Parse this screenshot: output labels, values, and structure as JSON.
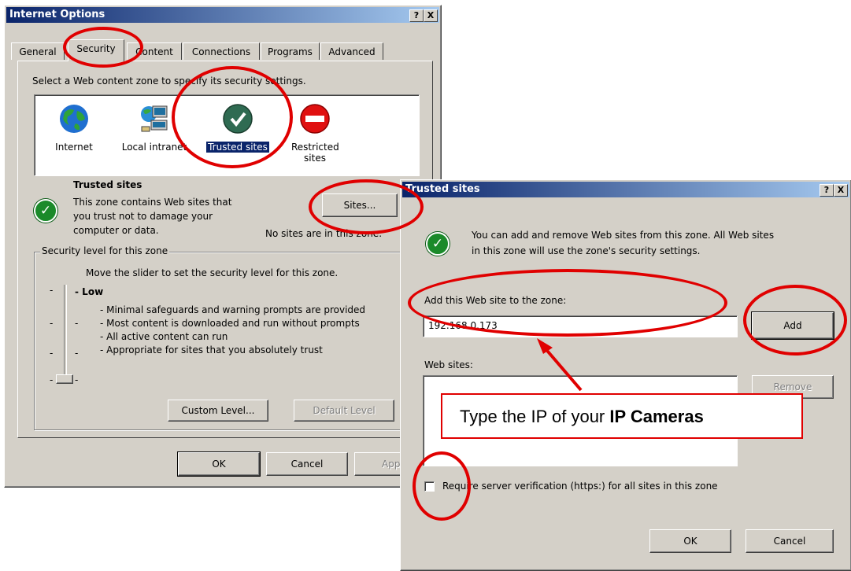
{
  "internet_options": {
    "title": "Internet Options",
    "help_btn": "?",
    "close_btn": "X",
    "tabs": [
      "General",
      "Security",
      "Content",
      "Connections",
      "Programs",
      "Advanced"
    ],
    "active_tab": "Security",
    "zone_prompt": "Select a Web content zone to specify its security settings.",
    "zones": [
      {
        "label": "Internet",
        "icon": "globe-icon"
      },
      {
        "label": "Local intranet",
        "icon": "network-computers-icon"
      },
      {
        "label": "Trusted sites",
        "icon": "check-circle-icon"
      },
      {
        "label": "Restricted sites",
        "icon": "no-entry-icon"
      }
    ],
    "selected_zone_title": "Trusted sites",
    "zone_desc_1": "This zone contains Web sites that",
    "zone_desc_2": "you trust not to damage your",
    "zone_desc_3": "computer or data.",
    "sites_button": "Sites...",
    "no_sites": "No sites are in this zone.",
    "security_group_label": "Security level for this zone",
    "slider_instruction": "Move the slider to set the security level for this zone.",
    "level_name": "Low",
    "level_points": [
      "- Minimal safeguards and warning prompts are provided",
      "- Most content is downloaded and run without prompts",
      "- All active content can run",
      "- Appropriate for sites that you absolutely trust"
    ],
    "custom_level_button": "Custom Level...",
    "default_level_button": "Default Level",
    "ok_button": "OK",
    "cancel_button": "Cancel",
    "apply_button": "Apply"
  },
  "trusted_sites": {
    "title": "Trusted sites",
    "help_btn": "?",
    "close_btn": "X",
    "info_line_1": "You can add and remove Web sites from this zone. All Web sites",
    "info_line_2": "in this zone will use the zone's security settings.",
    "add_label": "Add this Web site to the zone:",
    "add_value": "192.168.0.173",
    "add_button": "Add",
    "websites_label": "Web sites:",
    "remove_button": "Remove",
    "require_https_label": "Require server verification (https:) for all sites in this zone",
    "ok_button": "OK",
    "cancel_button": "Cancel"
  },
  "annotation": {
    "callout_prefix": "Type the IP of your ",
    "callout_bold": "IP Cameras",
    "highlight_color": "#e00000"
  }
}
